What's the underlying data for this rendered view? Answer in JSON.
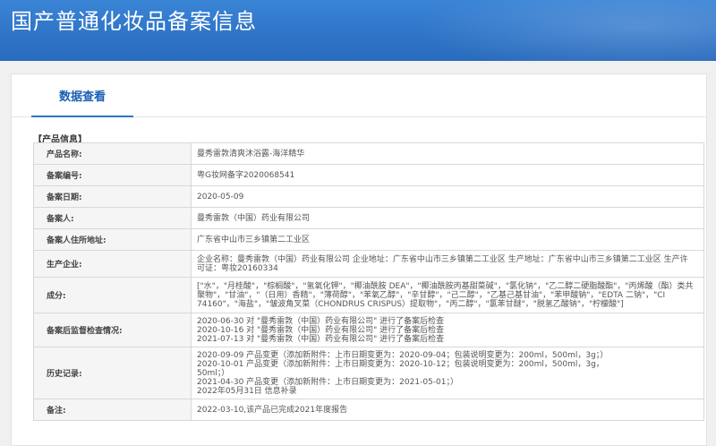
{
  "header": {
    "title": "国产普通化妆品备案信息"
  },
  "tabs": [
    {
      "label": "数据查看"
    }
  ],
  "section": {
    "label": "【产品信息】"
  },
  "rows": [
    {
      "label": "产品名称:",
      "value": "曼秀雷敦清爽沐浴露-海洋精华"
    },
    {
      "label": "备案编号:",
      "value": "粤G妆网备字2020068541"
    },
    {
      "label": "备案日期:",
      "value": "2020-05-09"
    },
    {
      "label": "备案人:",
      "value": "曼秀雷敦（中国）药业有限公司"
    },
    {
      "label": "备案人住所地址:",
      "value": "广东省中山市三乡镇第二工业区"
    },
    {
      "label": "生产企业:",
      "lines": [
        "企业名称：曼秀雷敦（中国）药业有限公司 企业地址：广东省中山市三乡镇第二工业区 生产地址：广东省中山市三乡镇第二工业区 生产许",
        "可证：粤妆20160334"
      ]
    },
    {
      "label": "成分:",
      "lines": [
        "[\"水\"，\"月桂酸\"，\"棕榈酸\"，\"氢氧化钾\"，\"椰油酰胺 DEA\"，\"椰油酰胺丙基甜菜碱\"，\"氯化钠\"，\"乙二醇二硬脂酸酯\"，\"丙烯酸（酯）类共",
        "聚物\"，\"甘油\"，\"（日用）香精\"，\"薄荷醇\"，\"苯氧乙醇\"，\"辛甘醇\"，\"己二醇\"，\"乙基己基甘油\"，\"苯甲酸钠\"，\"EDTA 二钠\"，\"CI",
        "74160\"，\"海盐\"，\"皱波角叉菜（CHONDRUS CRISPUS）提取物\"，\"丙二醇\"，\"氯苯甘醚\"，\"脱氢乙酸钠\"，\"柠檬酸\"]"
      ]
    },
    {
      "label": "备案后监督检查情况:",
      "lines": [
        "2020-06-30 对 \"曼秀雷敦（中国）药业有限公司\" 进行了备案后检查",
        "2020-10-16 对 \"曼秀雷敦（中国）药业有限公司\" 进行了备案后检查",
        "2021-07-13 对 \"曼秀雷敦（中国）药业有限公司\" 进行了备案后检查"
      ]
    },
    {
      "label": "历史记录:",
      "lines": [
        "2020-09-09 产品变更（添加新附件：上市日期变更为：2020-09-04；包装说明变更为：200ml，500ml，3g；）",
        "2020-10-01 产品变更（添加新附件：上市日期变更为：2020-10-12；包装说明变更为：200ml，500ml，3g，",
        "50ml；）",
        "2021-04-30 产品变更（添加新附件：上市日期变更为：2021-05-01；）",
        "2022年05月31日 信息补录"
      ]
    },
    {
      "label": "备注:",
      "value": "2022-03-10,该产品已完成2021年度报告"
    }
  ]
}
